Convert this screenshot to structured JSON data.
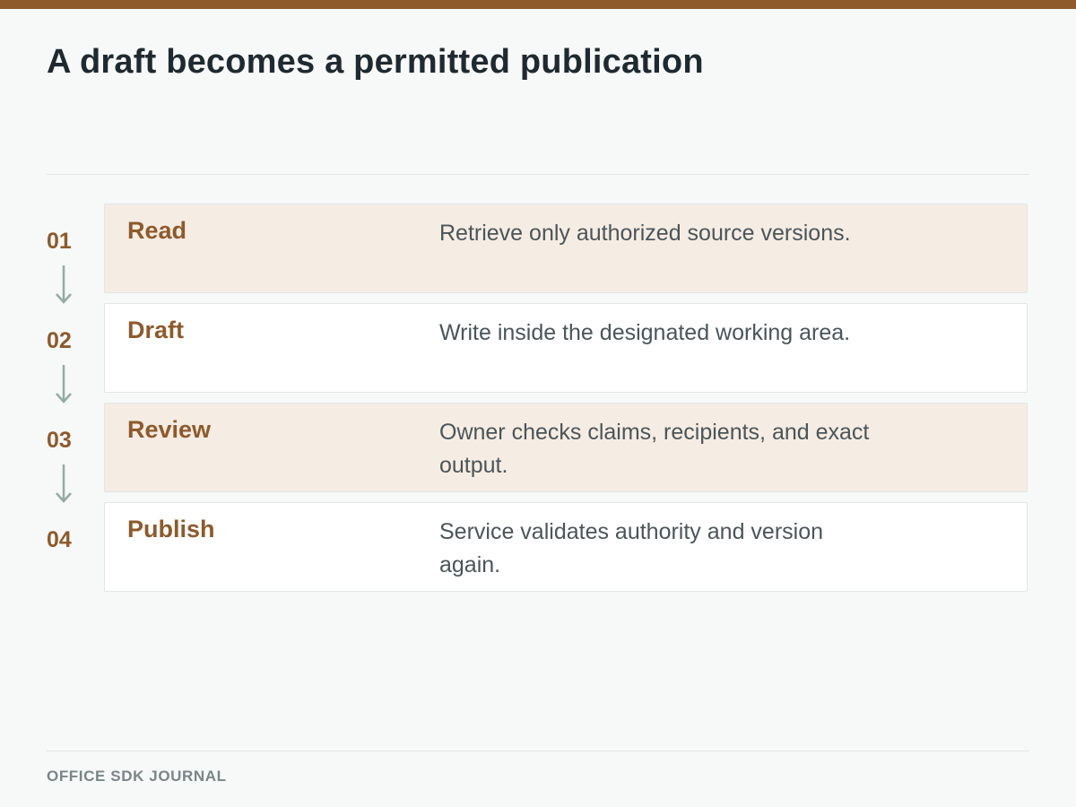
{
  "title": "A draft becomes a permitted publication",
  "colors": {
    "accent": "#8e5a2b",
    "shaded_card": "#f5ece3",
    "arrow": "#93aba5",
    "background": "#f7f8f8"
  },
  "steps": [
    {
      "number": "01",
      "label": "Read",
      "description": "Retrieve only authorized source versions."
    },
    {
      "number": "02",
      "label": "Draft",
      "description": "Write inside the designated working area."
    },
    {
      "number": "03",
      "label": "Review",
      "description": "Owner checks claims, recipients, and exact output."
    },
    {
      "number": "04",
      "label": "Publish",
      "description": "Service validates authority and version again."
    }
  ],
  "footer": "OFFICE SDK JOURNAL"
}
